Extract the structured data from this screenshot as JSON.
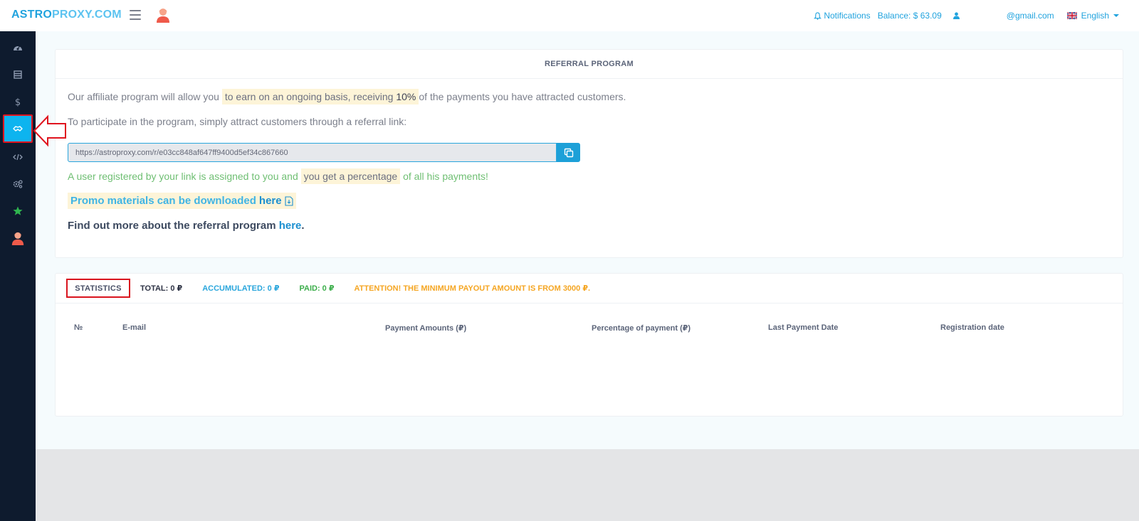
{
  "header": {
    "logo_part1": "ASTRO",
    "logo_part2": "PROXY.COM",
    "notifications_label": "Notifications",
    "balance_label": "Balance: $ 63.09",
    "user_email": "@gmail.com",
    "language": "English"
  },
  "sidebar": {
    "items": [
      {
        "icon": "dashboard-icon"
      },
      {
        "icon": "list-icon"
      },
      {
        "icon": "dollar-icon"
      },
      {
        "icon": "handshake-icon",
        "active": true
      },
      {
        "icon": "code-icon"
      },
      {
        "icon": "gears-icon"
      },
      {
        "icon": "star-icon"
      },
      {
        "icon": "support-agent-icon"
      }
    ]
  },
  "referral": {
    "title": "REFERRAL PROGRAM",
    "intro_prefix": "Our affiliate program will allow you",
    "intro_highlight": "to earn on an ongoing basis, receiving",
    "intro_percent": "10%",
    "intro_suffix": "of the payments you have attracted customers.",
    "participate_text": "To participate in the program, simply attract customers through a referral link:",
    "referral_link": "https://astroproxy.com/r/e03cc848af647ff9400d5ef34c867660",
    "assigned_prefix": "A user registered by your link is assigned to you and",
    "assigned_highlight": "you get a percentage",
    "assigned_suffix": "of all his payments!",
    "promo_text": "Promo materials can be downloaded",
    "promo_link": "here",
    "findout_text": "Find out more about the referral program",
    "findout_link": "here",
    "findout_dot": "."
  },
  "statistics": {
    "tab_label": "STATISTICS",
    "total": "TOTAL: 0 ₽",
    "accumulated": "ACCUMULATED: 0 ₽",
    "paid": "PAID: 0 ₽",
    "attention": "ATTENTION! THE MINIMUM PAYOUT AMOUNT IS FROM 3000 ₽.",
    "columns": [
      "№",
      "E-mail",
      "Payment Amounts (₽)",
      "Percentage of payment (₽)",
      "Last Payment Date",
      "Registration date"
    ]
  },
  "colors": {
    "accent": "#21a3de",
    "sidebar": "#0e1b2e",
    "active": "#0db4ef",
    "annotation_red": "#e0141e"
  }
}
